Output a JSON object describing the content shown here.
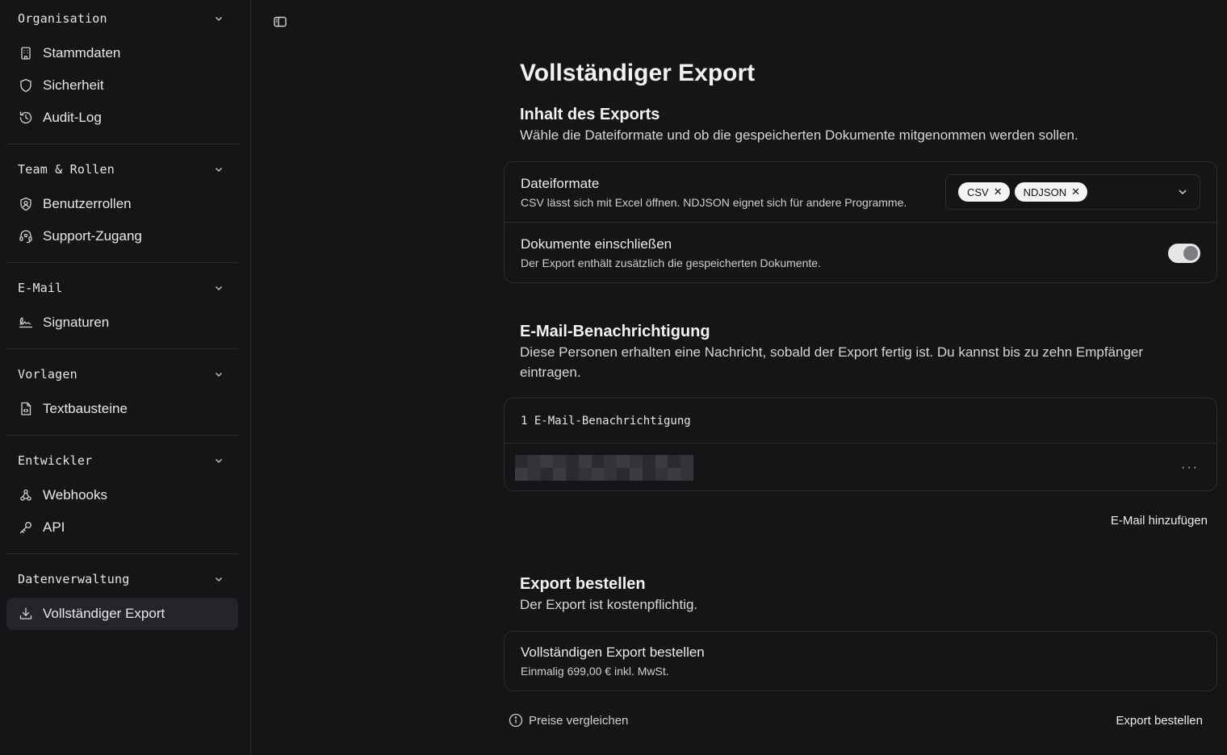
{
  "sidebar": {
    "groups": [
      {
        "title": "Organisation",
        "items": [
          {
            "label": "Stammdaten",
            "icon": "building-icon"
          },
          {
            "label": "Sicherheit",
            "icon": "shield-icon"
          },
          {
            "label": "Audit-Log",
            "icon": "history-icon"
          }
        ]
      },
      {
        "title": "Team & Rollen",
        "items": [
          {
            "label": "Benutzerrollen",
            "icon": "user-shield-icon"
          },
          {
            "label": "Support-Zugang",
            "icon": "headset-icon"
          }
        ]
      },
      {
        "title": "E-Mail",
        "items": [
          {
            "label": "Signaturen",
            "icon": "signature-icon"
          }
        ]
      },
      {
        "title": "Vorlagen",
        "items": [
          {
            "label": "Textbausteine",
            "icon": "file-code-icon"
          }
        ]
      },
      {
        "title": "Entwickler",
        "items": [
          {
            "label": "Webhooks",
            "icon": "webhook-icon"
          },
          {
            "label": "API",
            "icon": "key-icon"
          }
        ]
      },
      {
        "title": "Datenverwaltung",
        "items": [
          {
            "label": "Vollständiger Export",
            "icon": "download-icon",
            "active": true
          }
        ]
      }
    ]
  },
  "page": {
    "title": "Vollständiger Export"
  },
  "content_section": {
    "title": "Inhalt des Exports",
    "description": "Wähle die Dateiformate und ob die gespeicherten Dokumente mitgenommen werden sollen.",
    "formats": {
      "title": "Dateiformate",
      "subtitle": "CSV lässt sich mit Excel öffnen. NDJSON eignet sich für andere Programme.",
      "chips": [
        "CSV",
        "NDJSON"
      ]
    },
    "documents": {
      "title": "Dokumente einschließen",
      "subtitle": "Der Export enthält zusätzlich die gespeicherten Dokumente.",
      "enabled": true
    }
  },
  "email_section": {
    "title": "E-Mail-Benachrichtigung",
    "description": "Diese Personen erhalten eine Nachricht, sobald der Export fertig ist. Du kannst bis zu zehn Empfänger eintragen.",
    "count_label": "1 E-Mail-Benachrichtigung",
    "more_label": "···",
    "add_label": "E-Mail hinzufügen"
  },
  "order_section": {
    "title": "Export bestellen",
    "description": "Der Export ist kostenpflichtig.",
    "item_title": "Vollständigen Export bestellen",
    "item_price": "Einmalig 699,00 € inkl. MwSt.",
    "compare_label": "Preise vergleichen",
    "order_label": "Export bestellen"
  }
}
